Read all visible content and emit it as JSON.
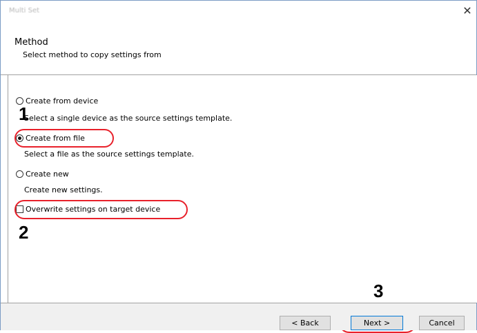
{
  "window": {
    "title": "Multi Set",
    "close_glyph": "✕"
  },
  "header": {
    "title": "Method",
    "subtitle": "Select method to copy settings from"
  },
  "options": [
    {
      "label": "Create from device",
      "description": "Select a single device as the source settings template.",
      "checked": false
    },
    {
      "label": "Create from file",
      "description": "Select a file as the source settings template.",
      "checked": true
    },
    {
      "label": "Create new",
      "description": "Create new settings.",
      "checked": false
    }
  ],
  "overwrite": {
    "label": "Overwrite settings on target device",
    "checked": false
  },
  "steps": {
    "one": "1",
    "two": "2",
    "three": "3"
  },
  "buttons": {
    "back": "< Back",
    "next": "Next >",
    "cancel": "Cancel"
  },
  "colors": {
    "highlight": "#e8202a",
    "accent": "#0078d7"
  }
}
